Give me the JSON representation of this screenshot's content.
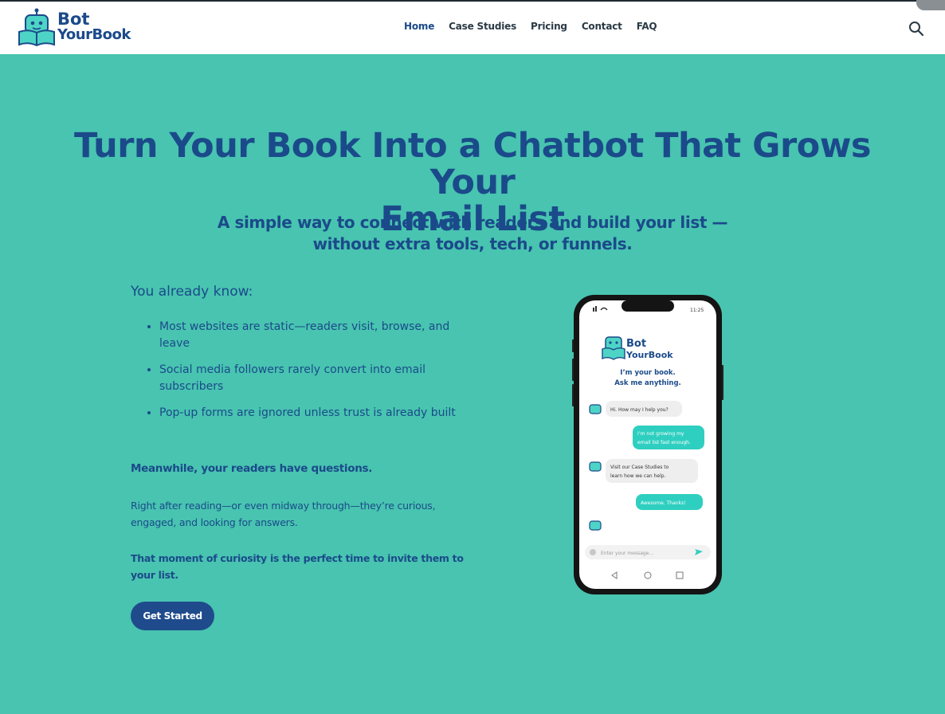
{
  "brand": {
    "line1": "Bot",
    "line2": "YourBook"
  },
  "nav": {
    "items": [
      {
        "label": "Home",
        "active": true
      },
      {
        "label": "Case Studies",
        "active": false
      },
      {
        "label": "Pricing",
        "active": false
      },
      {
        "label": "Contact",
        "active": false
      },
      {
        "label": "FAQ",
        "active": false
      }
    ],
    "search_icon": "search-icon"
  },
  "hero": {
    "title_line1": "Turn Your Book Into a Chatbot That Grows Your",
    "title_line2": "Email List",
    "subtitle_line1": "A simple way to connect with readers and build your list —",
    "subtitle_line2": "without extra tools, tech, or funnels."
  },
  "content": {
    "heading": "You already know:",
    "bullets": [
      "Most websites are static—readers visit, browse, and leave",
      "Social media followers rarely convert into email subscribers",
      "Pop-up forms are ignored unless trust is already built"
    ],
    "meanwhile": "Meanwhile, your readers have questions.",
    "curious": "Right after reading—or even midway through—they’re curious, engaged, and looking for answers.",
    "moment": "That moment of curiosity is the perfect time to invite them to your list.",
    "cta_label": "Get Started"
  },
  "phone": {
    "time": "11:25",
    "brand_line1": "Bot",
    "brand_line2": "YourBook",
    "tagline_line1": "I’m your book.",
    "tagline_line2": "Ask me anything.",
    "messages": [
      {
        "from": "bot",
        "text": "Hi. How may I help you?"
      },
      {
        "from": "user",
        "text_line1": "I’m not growing my",
        "text_line2": "email list fast enough."
      },
      {
        "from": "bot",
        "text_line1": "Visit our Case Studies to",
        "text_line2": "learn how we can help."
      },
      {
        "from": "user",
        "text": "Awesome. Thanks!"
      }
    ],
    "input_placeholder": "Enter your message..."
  },
  "colors": {
    "background": "#48c4b0",
    "brand_blue": "#1b4a8a",
    "cta": "#1f4b8c",
    "bubble_user": "#2ecfc0",
    "bubble_bot": "#eeeeee"
  }
}
